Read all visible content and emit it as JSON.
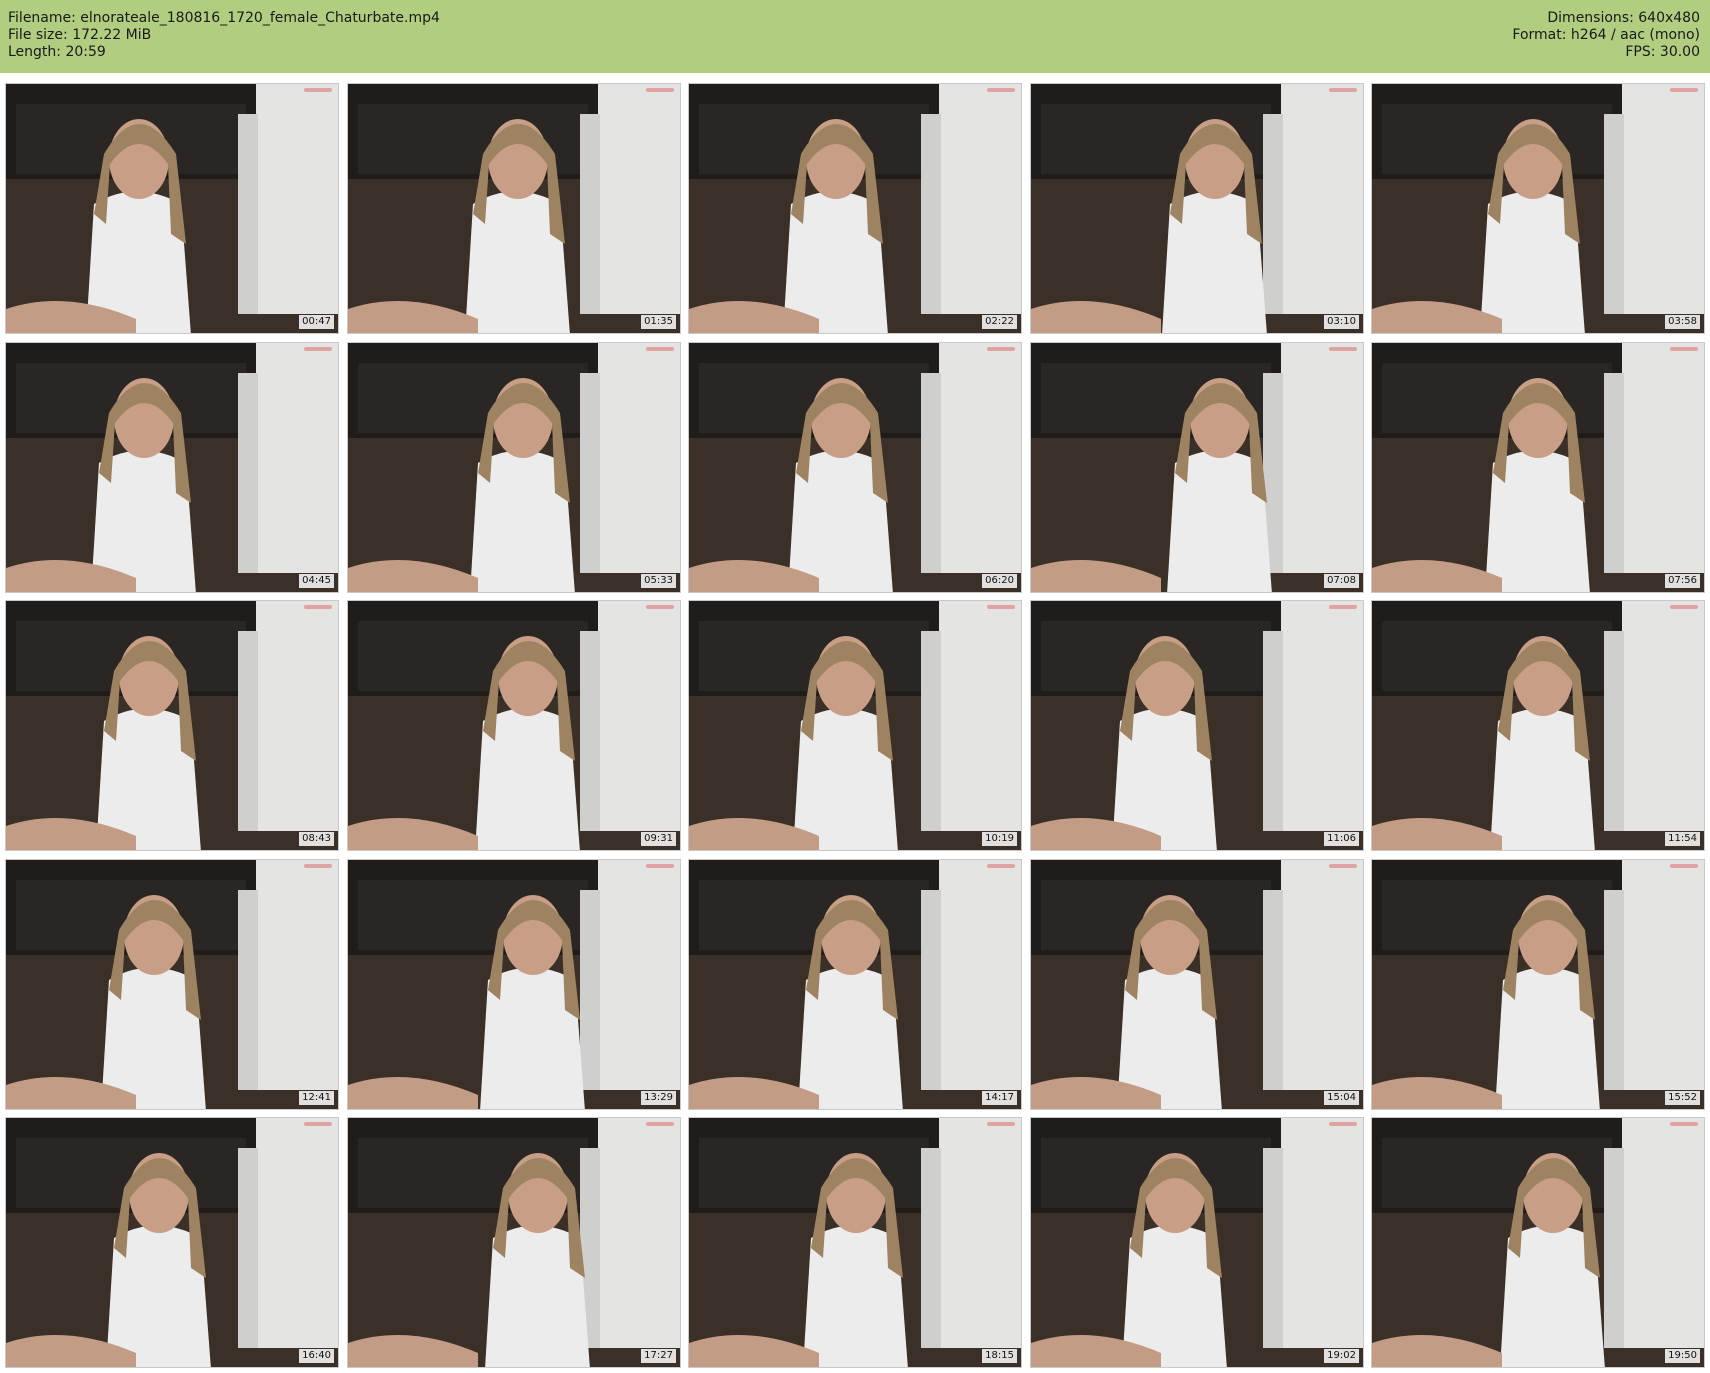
{
  "header": {
    "filename": "Filename: elnorateale_180816_1720_female_Chaturbate.mp4",
    "filesize": "File size: 172.22 MiB",
    "length": "Length: 20:59",
    "dimensions": "Dimensions: 640x480",
    "format": "Format: h264 / aac (mono)",
    "fps": "FPS: 30.00"
  },
  "colors": {
    "header_bg": "#b0cd80",
    "page_bg": "#ffffff"
  },
  "thumbnails": [
    {
      "timestamp": "00:47"
    },
    {
      "timestamp": "01:35"
    },
    {
      "timestamp": "02:22"
    },
    {
      "timestamp": "03:10"
    },
    {
      "timestamp": "03:58"
    },
    {
      "timestamp": "04:45"
    },
    {
      "timestamp": "05:33"
    },
    {
      "timestamp": "06:20"
    },
    {
      "timestamp": "07:08"
    },
    {
      "timestamp": "07:56"
    },
    {
      "timestamp": "08:43"
    },
    {
      "timestamp": "09:31"
    },
    {
      "timestamp": "10:19"
    },
    {
      "timestamp": "11:06"
    },
    {
      "timestamp": "11:54"
    },
    {
      "timestamp": "12:41"
    },
    {
      "timestamp": "13:29"
    },
    {
      "timestamp": "14:17"
    },
    {
      "timestamp": "15:04"
    },
    {
      "timestamp": "15:52"
    },
    {
      "timestamp": "16:40"
    },
    {
      "timestamp": "17:27"
    },
    {
      "timestamp": "18:15"
    },
    {
      "timestamp": "19:02"
    },
    {
      "timestamp": "19:50"
    }
  ]
}
